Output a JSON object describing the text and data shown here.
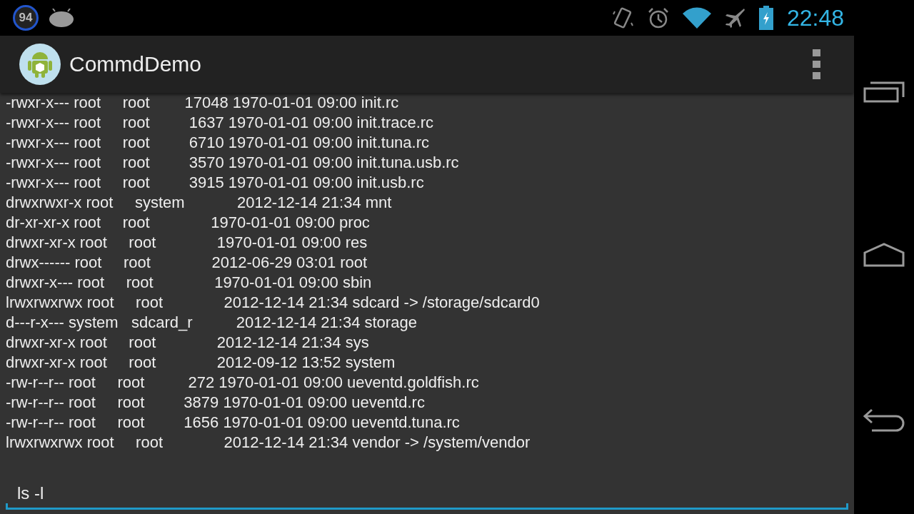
{
  "status_bar": {
    "badge": "94",
    "time": "22:48"
  },
  "action_bar": {
    "title": "CommdDemo"
  },
  "output": {
    "lines": [
      "-rwxr-x--- root     root        17048 1970-01-01 09:00 init.rc",
      "-rwxr-x--- root     root         1637 1970-01-01 09:00 init.trace.rc",
      "-rwxr-x--- root     root         6710 1970-01-01 09:00 init.tuna.rc",
      "-rwxr-x--- root     root         3570 1970-01-01 09:00 init.tuna.usb.rc",
      "-rwxr-x--- root     root         3915 1970-01-01 09:00 init.usb.rc",
      "drwxrwxr-x root     system            2012-12-14 21:34 mnt",
      "dr-xr-xr-x root     root              1970-01-01 09:00 proc",
      "drwxr-xr-x root     root              1970-01-01 09:00 res",
      "drwx------ root     root              2012-06-29 03:01 root",
      "drwxr-x--- root     root              1970-01-01 09:00 sbin",
      "lrwxrwxrwx root     root              2012-12-14 21:34 sdcard -> /storage/sdcard0",
      "d---r-x--- system   sdcard_r          2012-12-14 21:34 storage",
      "drwxr-xr-x root     root              2012-12-14 21:34 sys",
      "drwxr-xr-x root     root              2012-09-12 13:52 system",
      "-rw-r--r-- root     root          272 1970-01-01 09:00 ueventd.goldfish.rc",
      "-rw-r--r-- root     root         3879 1970-01-01 09:00 ueventd.rc",
      "-rw-r--r-- root     root         1656 1970-01-01 09:00 ueventd.tuna.rc",
      "lrwxrwxrwx root     root              2012-12-14 21:34 vendor -> /system/vendor"
    ]
  },
  "command_field": {
    "value": "ls -l"
  }
}
